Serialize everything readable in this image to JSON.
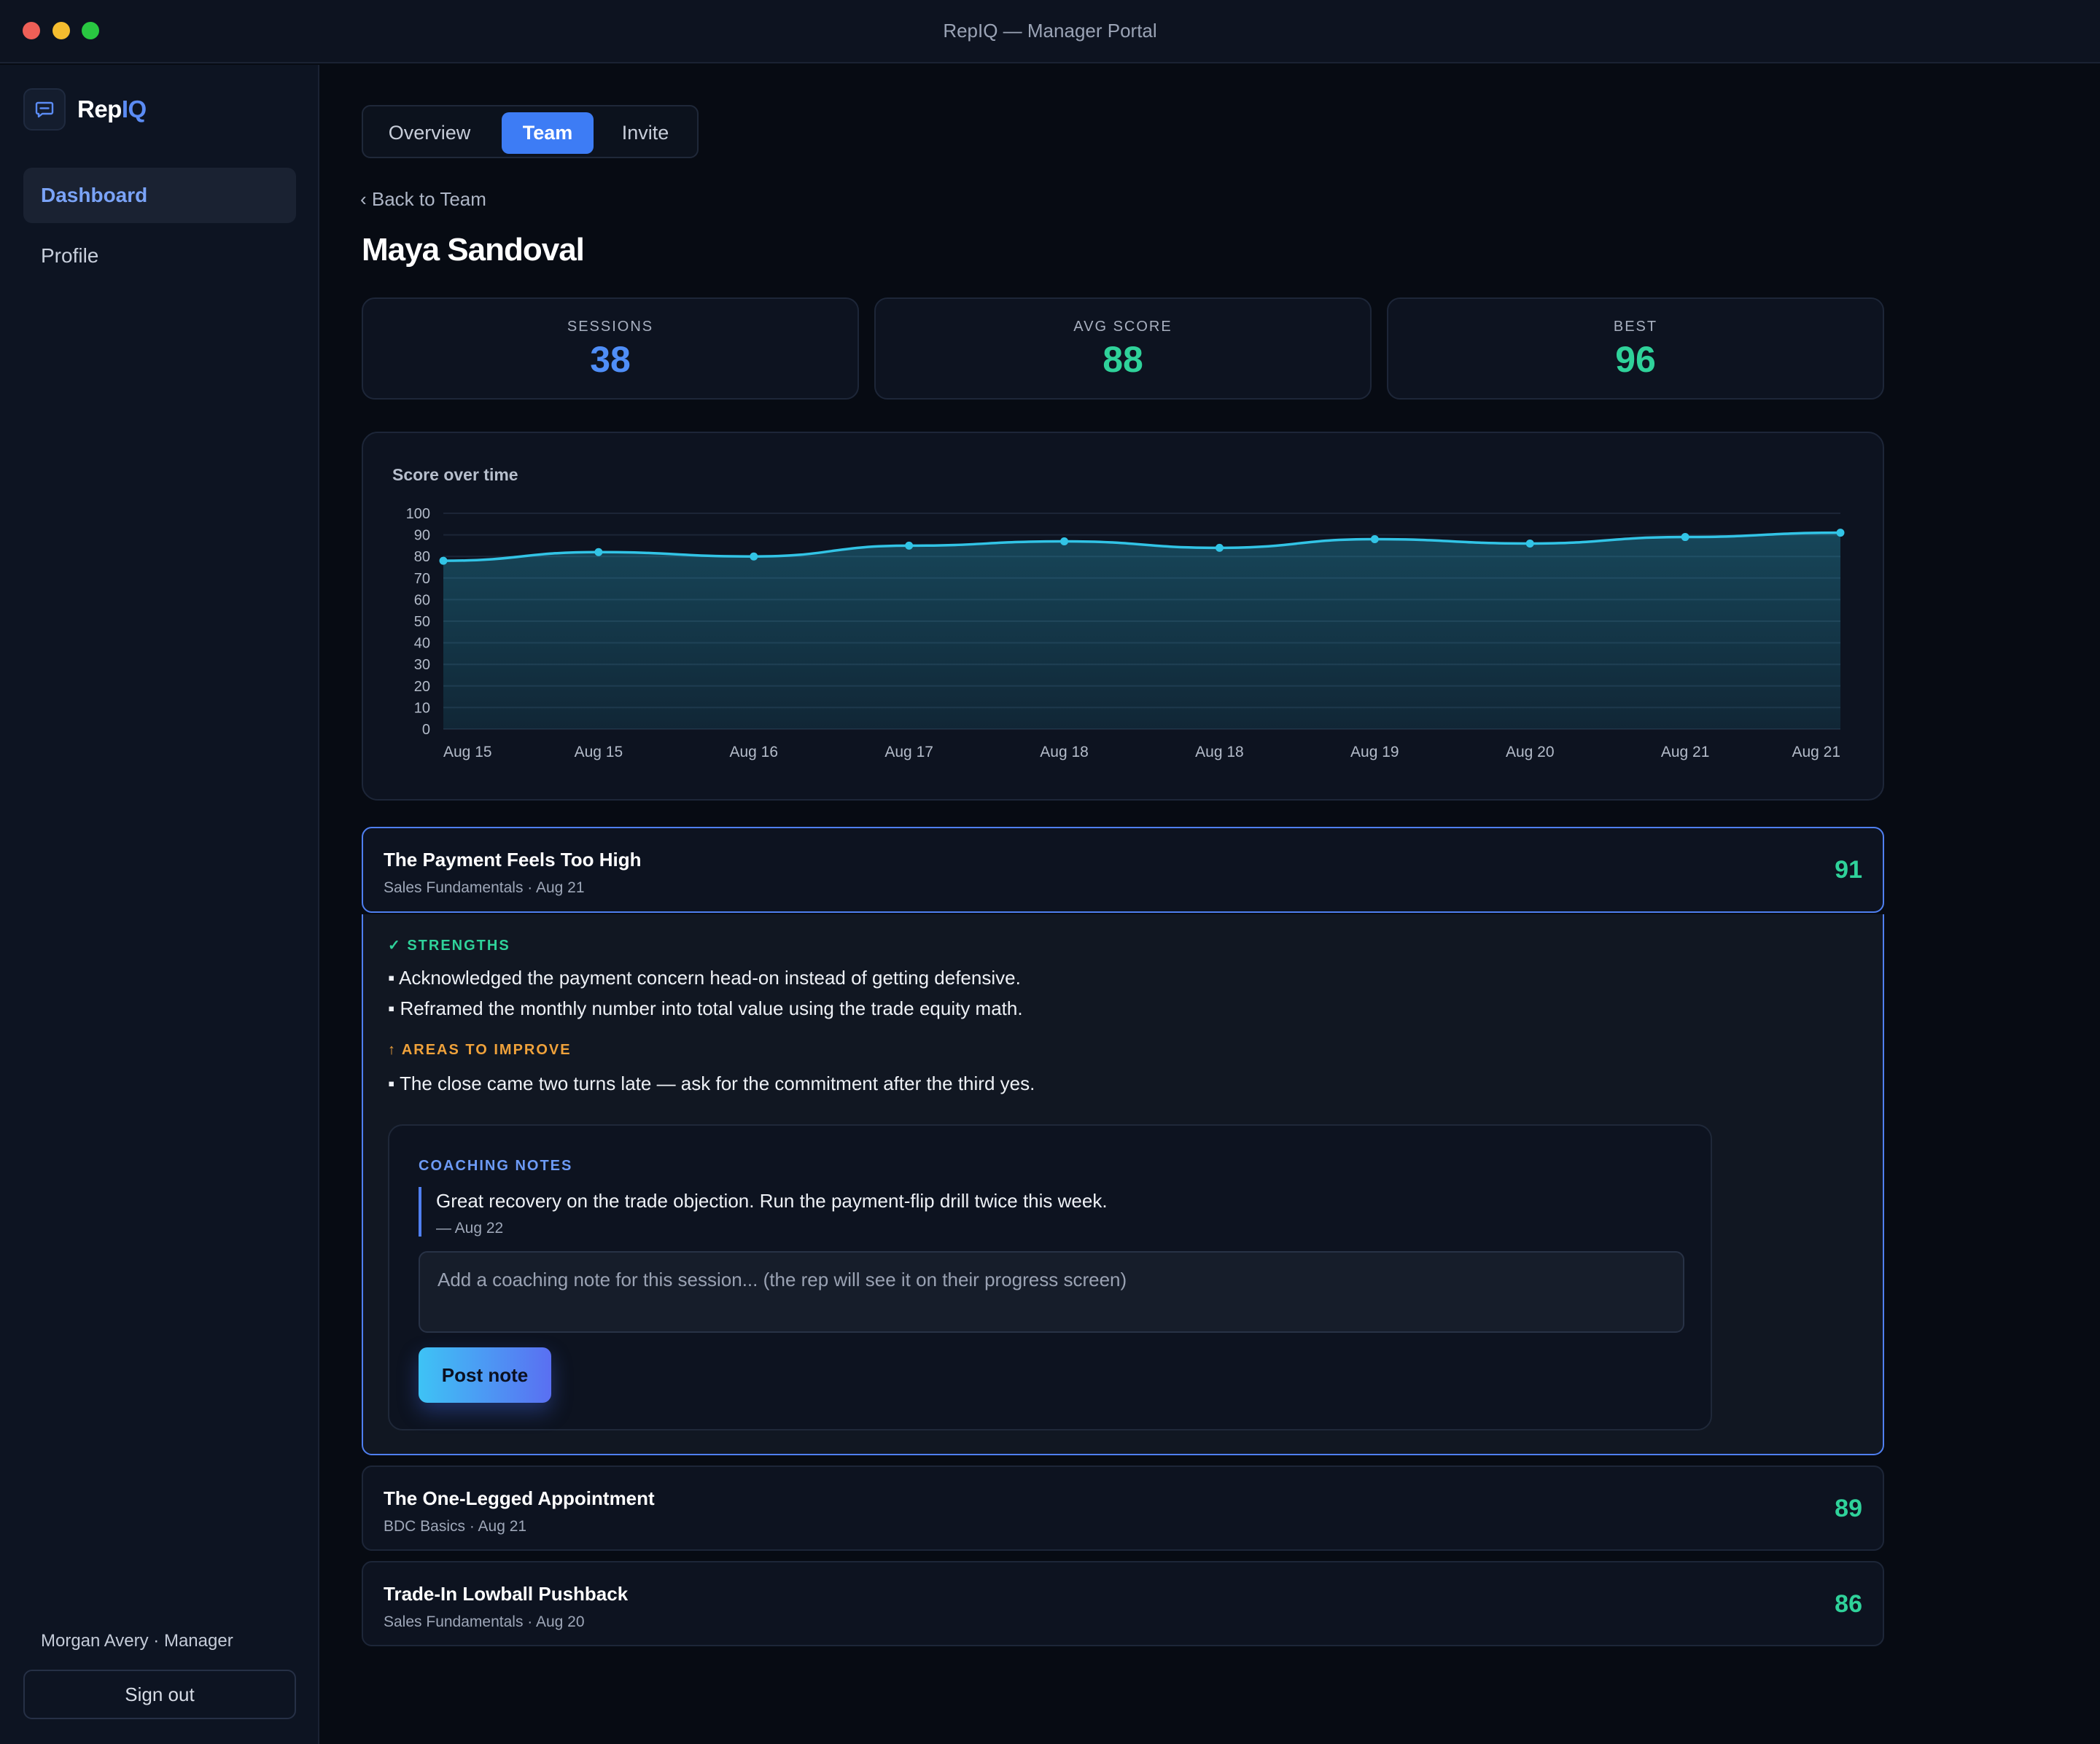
{
  "window": {
    "title": "RepIQ — Manager Portal"
  },
  "brand": {
    "name_main": "Rep",
    "name_accent": "IQ",
    "logo_icon": "chat-bubble-icon"
  },
  "sidebar": {
    "items": [
      {
        "label": "Dashboard",
        "active": true
      },
      {
        "label": "Profile",
        "active": false
      }
    ],
    "user": "Morgan Avery · Manager",
    "signout_label": "Sign out"
  },
  "tabs": [
    {
      "label": "Overview",
      "active": false
    },
    {
      "label": "Team",
      "active": true
    },
    {
      "label": "Invite",
      "active": false
    }
  ],
  "back_link": "‹ Back to Team",
  "rep_name": "Maya Sandoval",
  "stats": [
    {
      "label": "SESSIONS",
      "value": "38",
      "color": "#4f8ef7"
    },
    {
      "label": "AVG SCORE",
      "value": "88",
      "color": "#2fd29a"
    },
    {
      "label": "BEST",
      "value": "96",
      "color": "#2fd29a"
    }
  ],
  "chart_data": {
    "type": "area",
    "title": "Score over time",
    "xlabel": "",
    "ylabel": "",
    "categories": [
      "Aug 15",
      "Aug 15",
      "Aug 16",
      "Aug 17",
      "Aug 18",
      "Aug 18",
      "Aug 19",
      "Aug 20",
      "Aug 21",
      "Aug 21"
    ],
    "series": [
      {
        "values": [
          78,
          82,
          80,
          85,
          87,
          84,
          88,
          86,
          89,
          91
        ]
      }
    ],
    "ylim": [
      0,
      100
    ],
    "yticks": [
      100,
      90,
      80,
      70,
      60,
      50,
      40,
      30,
      20,
      10,
      0
    ],
    "grid": true,
    "line_color": "#32c4e6"
  },
  "sessions": [
    {
      "title": "The Payment Feels Too High",
      "meta": "Sales Fundamentals · Aug 21",
      "score": "91",
      "expanded": true
    },
    {
      "title": "The One-Legged Appointment",
      "meta": "BDC Basics · Aug 21",
      "score": "89"
    },
    {
      "title": "Trade-In Lowball Pushback",
      "meta": "Sales Fundamentals · Aug 20",
      "score": "86"
    }
  ],
  "detail": {
    "strengths_label": "✓ STRENGTHS",
    "strengths": [
      "▪ Acknowledged the payment concern head-on instead of getting defensive.",
      "▪ Reframed the monthly number into total value using the trade equity math."
    ],
    "improve_label": "↑ AREAS TO IMPROVE",
    "improve": [
      "▪ The close came two turns late — ask for the commitment after the third yes."
    ],
    "coaching": {
      "label": "COACHING NOTES",
      "note_text": "Great recovery on the trade objection. Run the payment-flip drill twice this week.",
      "note_date": "— Aug 22",
      "input_placeholder": "Add a coaching note for this session... (the rep will see it on their progress screen)",
      "input_value": "",
      "post_label": "Post note"
    }
  }
}
